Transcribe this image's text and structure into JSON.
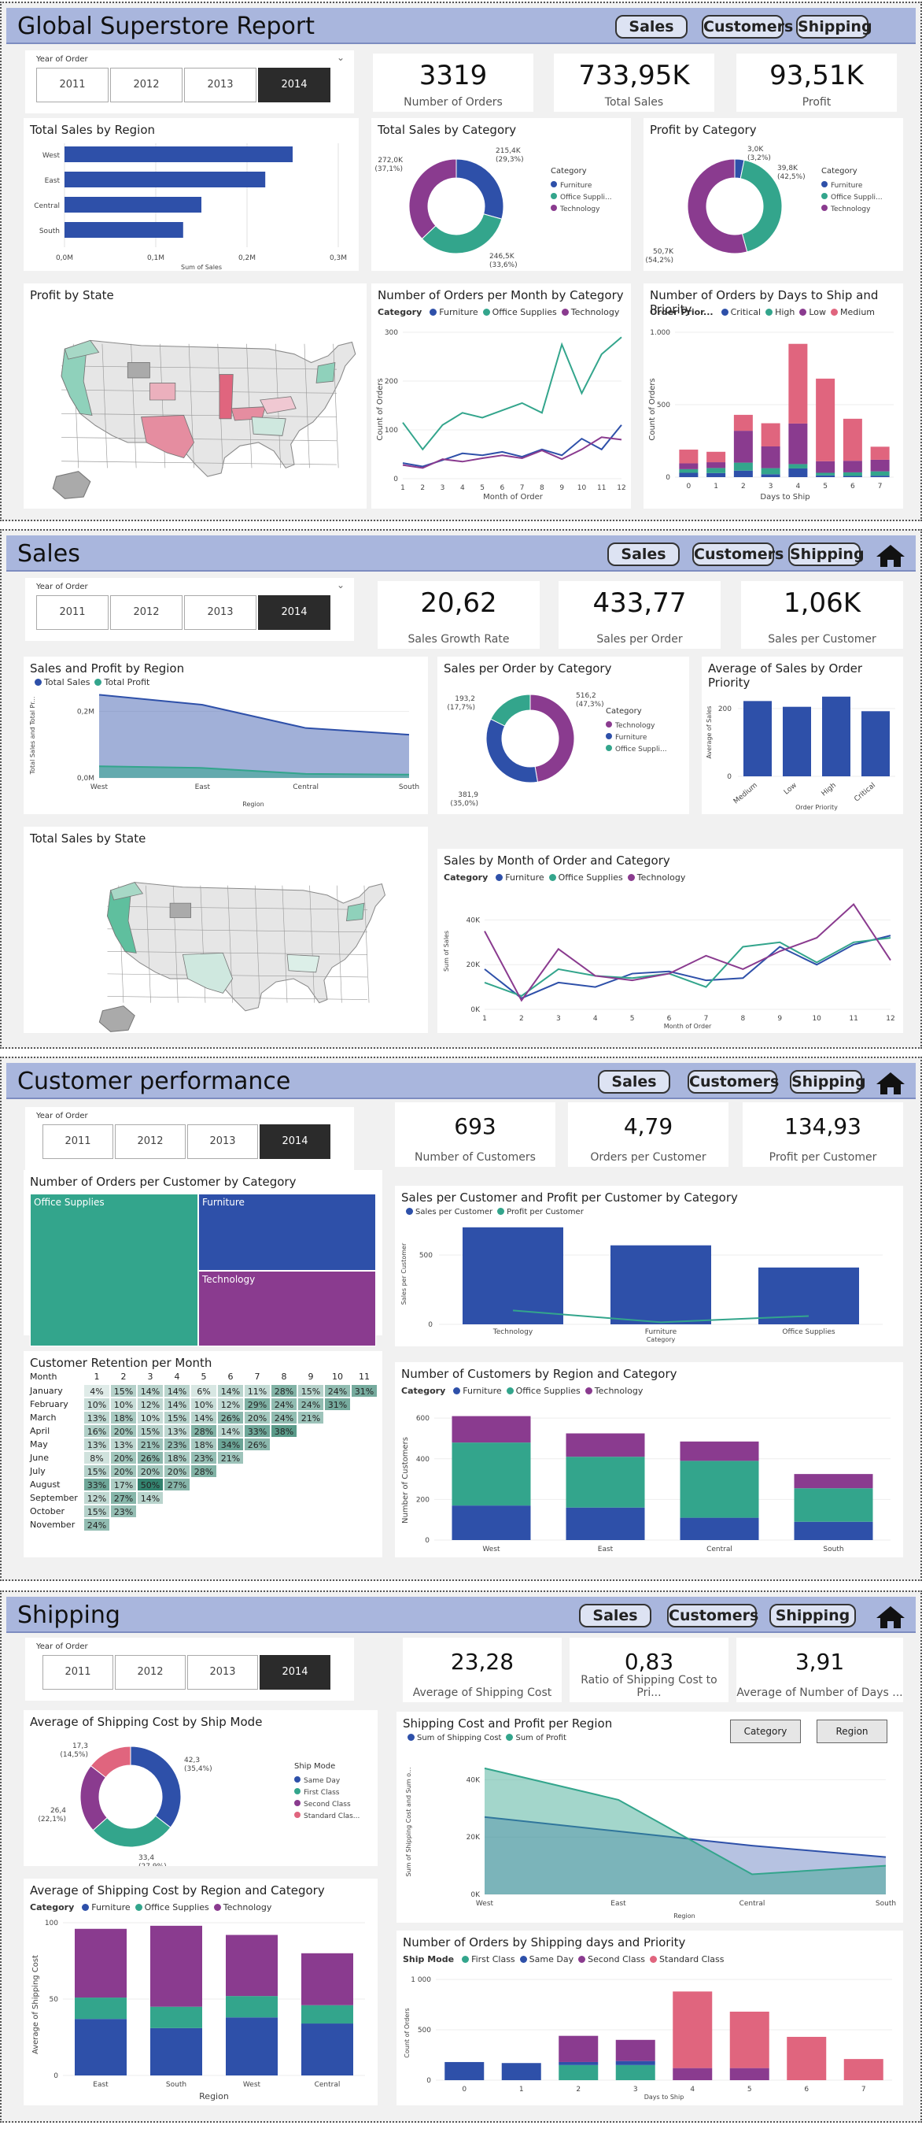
{
  "colors": {
    "blue": "#2e50a9",
    "teal": "#33a58c",
    "purple": "#8a3b8f",
    "pink": "#e0657e",
    "header": "#a9b6dd"
  },
  "nav": {
    "sales": "Sales",
    "customers": "Customers",
    "shipping": "Shipping"
  },
  "slicer": {
    "label": "Year of Order",
    "years": [
      "2011",
      "2012",
      "2013",
      "2014"
    ],
    "selected": "2014"
  },
  "overview": {
    "title": "Global Superstore Report",
    "kpis": [
      {
        "value": "3319",
        "label": "Number of Orders"
      },
      {
        "value": "733,95K",
        "label": "Total Sales"
      },
      {
        "value": "93,51K",
        "label": "Profit"
      }
    ],
    "region_sales": {
      "title": "Total Sales by Region",
      "xlabel": "Sum of Sales",
      "ticks": [
        "0,0M",
        "0,1M",
        "0,2M",
        "0,3M"
      ]
    },
    "cat_sales": {
      "title": "Total Sales by Category",
      "legend_title": "Category"
    },
    "cat_profit": {
      "title": "Profit by Category",
      "legend_title": "Category"
    },
    "state_profit": {
      "title": "Profit by State"
    },
    "orders_month": {
      "title": "Number of Orders per Month by Category",
      "legend_title": "Category",
      "xlabel": "Month of Order",
      "ylabel": "Count of Orders"
    },
    "orders_days": {
      "title": "Number of Orders by Days to Ship and Priority",
      "legend_title": "Order Prior...",
      "xlabel": "Days to Ship",
      "ylabel": "Count of Orders"
    }
  },
  "sales": {
    "title": "Sales",
    "kpis": [
      {
        "value": "20,62",
        "label": "Sales Growth Rate"
      },
      {
        "value": "433,77",
        "label": "Sales per Order"
      },
      {
        "value": "1,06K",
        "label": "Sales per Customer"
      }
    ],
    "region": {
      "title": "Sales and Profit by Region",
      "xlabel": "Region",
      "ylabel": "Total Sales and Total Pr...",
      "ticks": [
        "0,0M",
        "0,2M"
      ]
    },
    "order_cat": {
      "title": "Sales per Order by Category",
      "legend_title": "Category"
    },
    "priority": {
      "title": "Average of Sales by Order Priority",
      "xlabel": "Order Priority",
      "ylabel": "Average of Sales"
    },
    "state": {
      "title": "Total Sales by State"
    },
    "month": {
      "title": "Sales by Month of Order and Category",
      "legend_title": "Category",
      "xlabel": "Month of Order",
      "ylabel": "Sum of Sales"
    }
  },
  "customers": {
    "title": "Customer performance",
    "kpis": [
      {
        "value": "693",
        "label": "Number of Customers"
      },
      {
        "value": "4,79",
        "label": "Orders per Customer"
      },
      {
        "value": "134,93",
        "label": "Profit per Customer"
      }
    ],
    "treemap": {
      "title": "Number of Orders per Customer by Category",
      "labels": [
        "Office Supplies",
        "Furniture",
        "Technology"
      ]
    },
    "retention": {
      "title": "Customer Retention per Month",
      "corner": "Month",
      "cols": [
        "1",
        "2",
        "3",
        "4",
        "5",
        "6",
        "7",
        "8",
        "9",
        "10",
        "11"
      ],
      "rows": [
        {
          "m": "January",
          "v": [
            "4%",
            "15%",
            "14%",
            "14%",
            "6%",
            "14%",
            "11%",
            "28%",
            "15%",
            "24%",
            "31%"
          ]
        },
        {
          "m": "February",
          "v": [
            "10%",
            "10%",
            "12%",
            "14%",
            "10%",
            "12%",
            "29%",
            "24%",
            "24%",
            "31%"
          ]
        },
        {
          "m": "March",
          "v": [
            "13%",
            "18%",
            "10%",
            "15%",
            "14%",
            "26%",
            "20%",
            "24%",
            "21%"
          ]
        },
        {
          "m": "April",
          "v": [
            "16%",
            "20%",
            "15%",
            "13%",
            "28%",
            "14%",
            "33%",
            "38%"
          ]
        },
        {
          "m": "May",
          "v": [
            "13%",
            "13%",
            "21%",
            "23%",
            "18%",
            "34%",
            "26%"
          ]
        },
        {
          "m": "June",
          "v": [
            "8%",
            "20%",
            "26%",
            "18%",
            "23%",
            "21%"
          ]
        },
        {
          "m": "July",
          "v": [
            "15%",
            "20%",
            "20%",
            "20%",
            "28%"
          ]
        },
        {
          "m": "August",
          "v": [
            "33%",
            "17%",
            "50%",
            "27%"
          ]
        },
        {
          "m": "September",
          "v": [
            "12%",
            "27%",
            "14%"
          ]
        },
        {
          "m": "October",
          "v": [
            "15%",
            "23%"
          ]
        },
        {
          "m": "November",
          "v": [
            "24%"
          ]
        }
      ]
    },
    "spc": {
      "title": "Sales per Customer and Profit per Customer by Category",
      "xlabel": "Category",
      "ylabel": "Sales per Customer"
    },
    "region_cat": {
      "title": "Number of Customers by Region and Category",
      "legend_title": "Category",
      "ylabel": "Number of Customers"
    }
  },
  "shipping": {
    "title": "Shipping",
    "kpis": [
      {
        "value": "23,28",
        "label": "Average of Shipping Cost"
      },
      {
        "value": "0,83",
        "label": "Ratio of Shipping Cost to Pri..."
      },
      {
        "value": "3,91",
        "label": "Average of Number of Days ..."
      }
    ],
    "mode": {
      "title": "Average of Shipping Cost by Ship Mode",
      "legend_title": "Ship Mode"
    },
    "cost_profit": {
      "title": "Shipping Cost and Profit per Region",
      "xlabel": "Region",
      "ylabel": "Sum of Shipping Cost and Sum o...",
      "btn_category": "Category",
      "btn_region": "Region"
    },
    "region_cat": {
      "title": "Average of Shipping Cost by Region and Category",
      "legend_title": "Category",
      "xlabel": "Region",
      "ylabel": "Average of Shipping Cost"
    },
    "days": {
      "title": "Number of Orders by Shipping days and Priority",
      "legend_title": "Ship Mode",
      "xlabel": "Days to Ship",
      "ylabel": "Count of Orders"
    }
  },
  "chart_data": [
    {
      "id": "region_sales",
      "type": "bar",
      "orientation": "horizontal",
      "title": "Total Sales by Region",
      "categories": [
        "West",
        "East",
        "Central",
        "South"
      ],
      "values": [
        0.25,
        0.22,
        0.15,
        0.13
      ],
      "unit": "M",
      "xlabel": "Sum of Sales",
      "xlim": [
        0,
        0.3
      ]
    },
    {
      "id": "cat_sales",
      "type": "pie",
      "title": "Total Sales by Category",
      "categories": [
        "Furniture",
        "Office Supplies",
        "Technology"
      ],
      "values": [
        215.4,
        246.5,
        272.0
      ],
      "labels": [
        "215,4K (29,3%)",
        "246,5K (33,6%)",
        "272,0K (37,1%)"
      ]
    },
    {
      "id": "cat_profit",
      "type": "pie",
      "title": "Profit by Category",
      "categories": [
        "Furniture",
        "Office Supplies",
        "Technology"
      ],
      "values": [
        3.0,
        39.8,
        50.7
      ],
      "labels": [
        "3,0K (3,2%)",
        "39,8K (42,5%)",
        "50,7K (54,2%)"
      ]
    },
    {
      "id": "orders_month",
      "type": "line",
      "title": "Number of Orders per Month by Category",
      "x": [
        1,
        2,
        3,
        4,
        5,
        6,
        7,
        8,
        9,
        10,
        11,
        12
      ],
      "series": [
        {
          "name": "Furniture",
          "values": [
            32,
            25,
            38,
            52,
            48,
            55,
            45,
            60,
            48,
            82,
            60,
            110
          ]
        },
        {
          "name": "Office Supplies",
          "values": [
            115,
            60,
            110,
            135,
            125,
            140,
            155,
            135,
            275,
            175,
            255,
            290
          ]
        },
        {
          "name": "Technology",
          "values": [
            28,
            22,
            40,
            35,
            42,
            48,
            42,
            58,
            40,
            60,
            85,
            80
          ]
        }
      ],
      "ylim": [
        0,
        300
      ],
      "xlabel": "Month of Order",
      "ylabel": "Count of Orders"
    },
    {
      "id": "orders_days",
      "type": "bar",
      "stacked": true,
      "title": "Number of Orders by Days to Ship and Priority",
      "categories": [
        "0",
        "1",
        "2",
        "3",
        "4",
        "5",
        "6",
        "7"
      ],
      "series": [
        {
          "name": "Critical",
          "values": [
            30,
            28,
            45,
            20,
            60,
            12,
            8,
            10
          ]
        },
        {
          "name": "High",
          "values": [
            25,
            35,
            55,
            42,
            30,
            18,
            25,
            30
          ]
        },
        {
          "name": "Low",
          "values": [
            40,
            40,
            220,
            150,
            280,
            80,
            80,
            80
          ]
        },
        {
          "name": "Medium",
          "values": [
            95,
            72,
            110,
            160,
            550,
            570,
            290,
            90
          ]
        }
      ],
      "ylim": [
        0,
        1000
      ],
      "xlabel": "Days to Ship",
      "ylabel": "Count of Orders"
    },
    {
      "id": "sales_region",
      "type": "area",
      "title": "Sales and Profit by Region",
      "categories": [
        "West",
        "East",
        "Central",
        "South"
      ],
      "series": [
        {
          "name": "Total Sales",
          "values": [
            0.25,
            0.22,
            0.15,
            0.13
          ]
        },
        {
          "name": "Total Profit",
          "values": [
            0.035,
            0.03,
            0.012,
            0.01
          ]
        }
      ],
      "unit": "M",
      "ylabel": "Total Sales and Total Pr...",
      "xlabel": "Region"
    },
    {
      "id": "sales_order_cat",
      "type": "pie",
      "title": "Sales per Order by Category",
      "categories": [
        "Technology",
        "Furniture",
        "Office Supplies"
      ],
      "values": [
        516.2,
        381.9,
        193.2
      ],
      "labels": [
        "516,2 (47,3%)",
        "381,9 (35,0%)",
        "193,2 (17,7%)"
      ]
    },
    {
      "id": "sales_priority",
      "type": "bar",
      "title": "Average of Sales by Order Priority",
      "categories": [
        "Medium",
        "Low",
        "High",
        "Critical"
      ],
      "values": [
        222,
        205,
        235,
        192
      ],
      "ylim": [
        0,
        260
      ],
      "xlabel": "Order Priority",
      "ylabel": "Average of Sales"
    },
    {
      "id": "sales_month",
      "type": "line",
      "title": "Sales by Month of Order and Category",
      "x": [
        1,
        2,
        3,
        4,
        5,
        6,
        7,
        8,
        9,
        10,
        11,
        12
      ],
      "series": [
        {
          "name": "Furniture",
          "values": [
            18000,
            5000,
            12000,
            10000,
            16000,
            17000,
            13000,
            14000,
            28000,
            20000,
            29000,
            33000
          ]
        },
        {
          "name": "Office Supplies",
          "values": [
            12000,
            6000,
            18000,
            15000,
            14000,
            16000,
            10000,
            28000,
            30000,
            21000,
            30000,
            32000
          ]
        },
        {
          "name": "Technology",
          "values": [
            35000,
            4000,
            27000,
            15000,
            13000,
            16000,
            24000,
            18000,
            26000,
            32000,
            47000,
            22000
          ]
        }
      ],
      "ylim": [
        0,
        50000
      ],
      "xlabel": "Month of Order",
      "ylabel": "Sum of Sales"
    },
    {
      "id": "treemap",
      "type": "heatmap",
      "title": "Number of Orders per Customer by Category",
      "categories": [
        "Office Supplies",
        "Furniture",
        "Technology"
      ]
    },
    {
      "id": "spc",
      "type": "bar",
      "title": "Sales per Customer and Profit per Customer by Category",
      "categories": [
        "Technology",
        "Furniture",
        "Office Supplies"
      ],
      "series": [
        {
          "name": "Sales per Customer",
          "values": [
            700,
            570,
            410
          ]
        },
        {
          "name": "Profit per Customer",
          "values": [
            100,
            15,
            60
          ]
        }
      ],
      "ylim": [
        0,
        750
      ],
      "xlabel": "Category",
      "ylabel": "Sales per Customer"
    },
    {
      "id": "cust_region_cat",
      "type": "bar",
      "stacked": true,
      "title": "Number of Customers by Region and Category",
      "categories": [
        "West",
        "East",
        "Central",
        "South"
      ],
      "series": [
        {
          "name": "Furniture",
          "values": [
            170,
            160,
            110,
            90
          ]
        },
        {
          "name": "Office Supplies",
          "values": [
            310,
            250,
            280,
            165
          ]
        },
        {
          "name": "Technology",
          "values": [
            130,
            115,
            95,
            70
          ]
        }
      ],
      "ylim": [
        0,
        620
      ],
      "ylabel": "Number of Customers"
    },
    {
      "id": "ship_mode",
      "type": "pie",
      "title": "Average of Shipping Cost by Ship Mode",
      "categories": [
        "Same Day",
        "First Class",
        "Second Class",
        "Standard Class"
      ],
      "values": [
        42.3,
        33.4,
        26.4,
        17.3
      ],
      "labels": [
        "42,3 (35,4%)",
        "33,4 (27,9%)",
        "26,4 (22,1%)",
        "17,3 (14,5%)"
      ]
    },
    {
      "id": "ship_cost_profit",
      "type": "area",
      "title": "Shipping Cost and Profit per Region",
      "categories": [
        "West",
        "East",
        "Central",
        "South"
      ],
      "series": [
        {
          "name": "Sum of Shipping Cost",
          "values": [
            27000,
            22000,
            17000,
            13000
          ]
        },
        {
          "name": "Sum of Profit",
          "values": [
            44000,
            33000,
            7000,
            10000
          ]
        }
      ],
      "ylim": [
        0,
        50000
      ],
      "xlabel": "Region"
    },
    {
      "id": "ship_region_cat",
      "type": "bar",
      "stacked": true,
      "title": "Average of Shipping Cost by Region and Category",
      "categories": [
        "East",
        "South",
        "West",
        "Central"
      ],
      "series": [
        {
          "name": "Furniture",
          "values": [
            37,
            31,
            38,
            34
          ]
        },
        {
          "name": "Office Supplies",
          "values": [
            14,
            14,
            14,
            12
          ]
        },
        {
          "name": "Technology",
          "values": [
            45,
            53,
            40,
            34
          ]
        }
      ],
      "ylim": [
        0,
        100
      ],
      "xlabel": "Region",
      "ylabel": "Average of Shipping Cost"
    },
    {
      "id": "ship_days",
      "type": "bar",
      "stacked": true,
      "title": "Number of Orders by Shipping days and Priority",
      "categories": [
        "0",
        "1",
        "2",
        "3",
        "4",
        "5",
        "6",
        "7"
      ],
      "series": [
        {
          "name": "First Class",
          "values": [
            0,
            0,
            150,
            150,
            0,
            0,
            0,
            0
          ]
        },
        {
          "name": "Same Day",
          "values": [
            180,
            170,
            30,
            40,
            0,
            0,
            0,
            0
          ]
        },
        {
          "name": "Second Class",
          "values": [
            0,
            0,
            260,
            210,
            120,
            120,
            0,
            0
          ]
        },
        {
          "name": "Standard Class",
          "values": [
            0,
            0,
            0,
            0,
            760,
            560,
            430,
            210
          ]
        }
      ],
      "ylim": [
        0,
        1000
      ],
      "xlabel": "Days to Ship",
      "ylabel": "Count of Orders"
    }
  ]
}
